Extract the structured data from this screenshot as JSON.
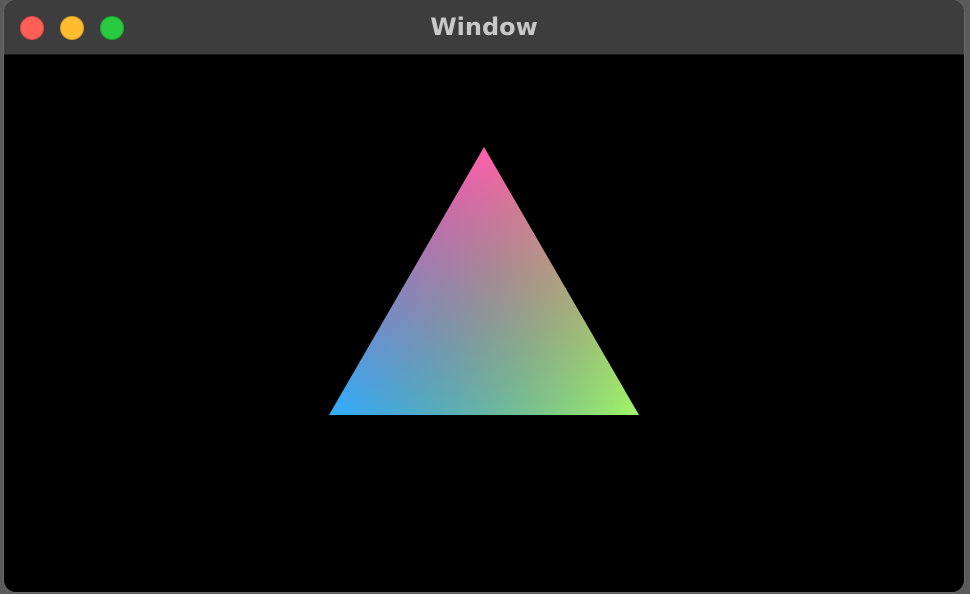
{
  "window": {
    "title": "Window",
    "controls": {
      "close": "close-button",
      "minimize": "minimize-button",
      "zoom": "zoom-button"
    }
  },
  "canvas": {
    "background": "#000000",
    "shape": "triangle",
    "vertex_colors": {
      "top": "#ff3399",
      "bottom_left": "#1ea0ff",
      "bottom_right": "#a0f550"
    }
  }
}
